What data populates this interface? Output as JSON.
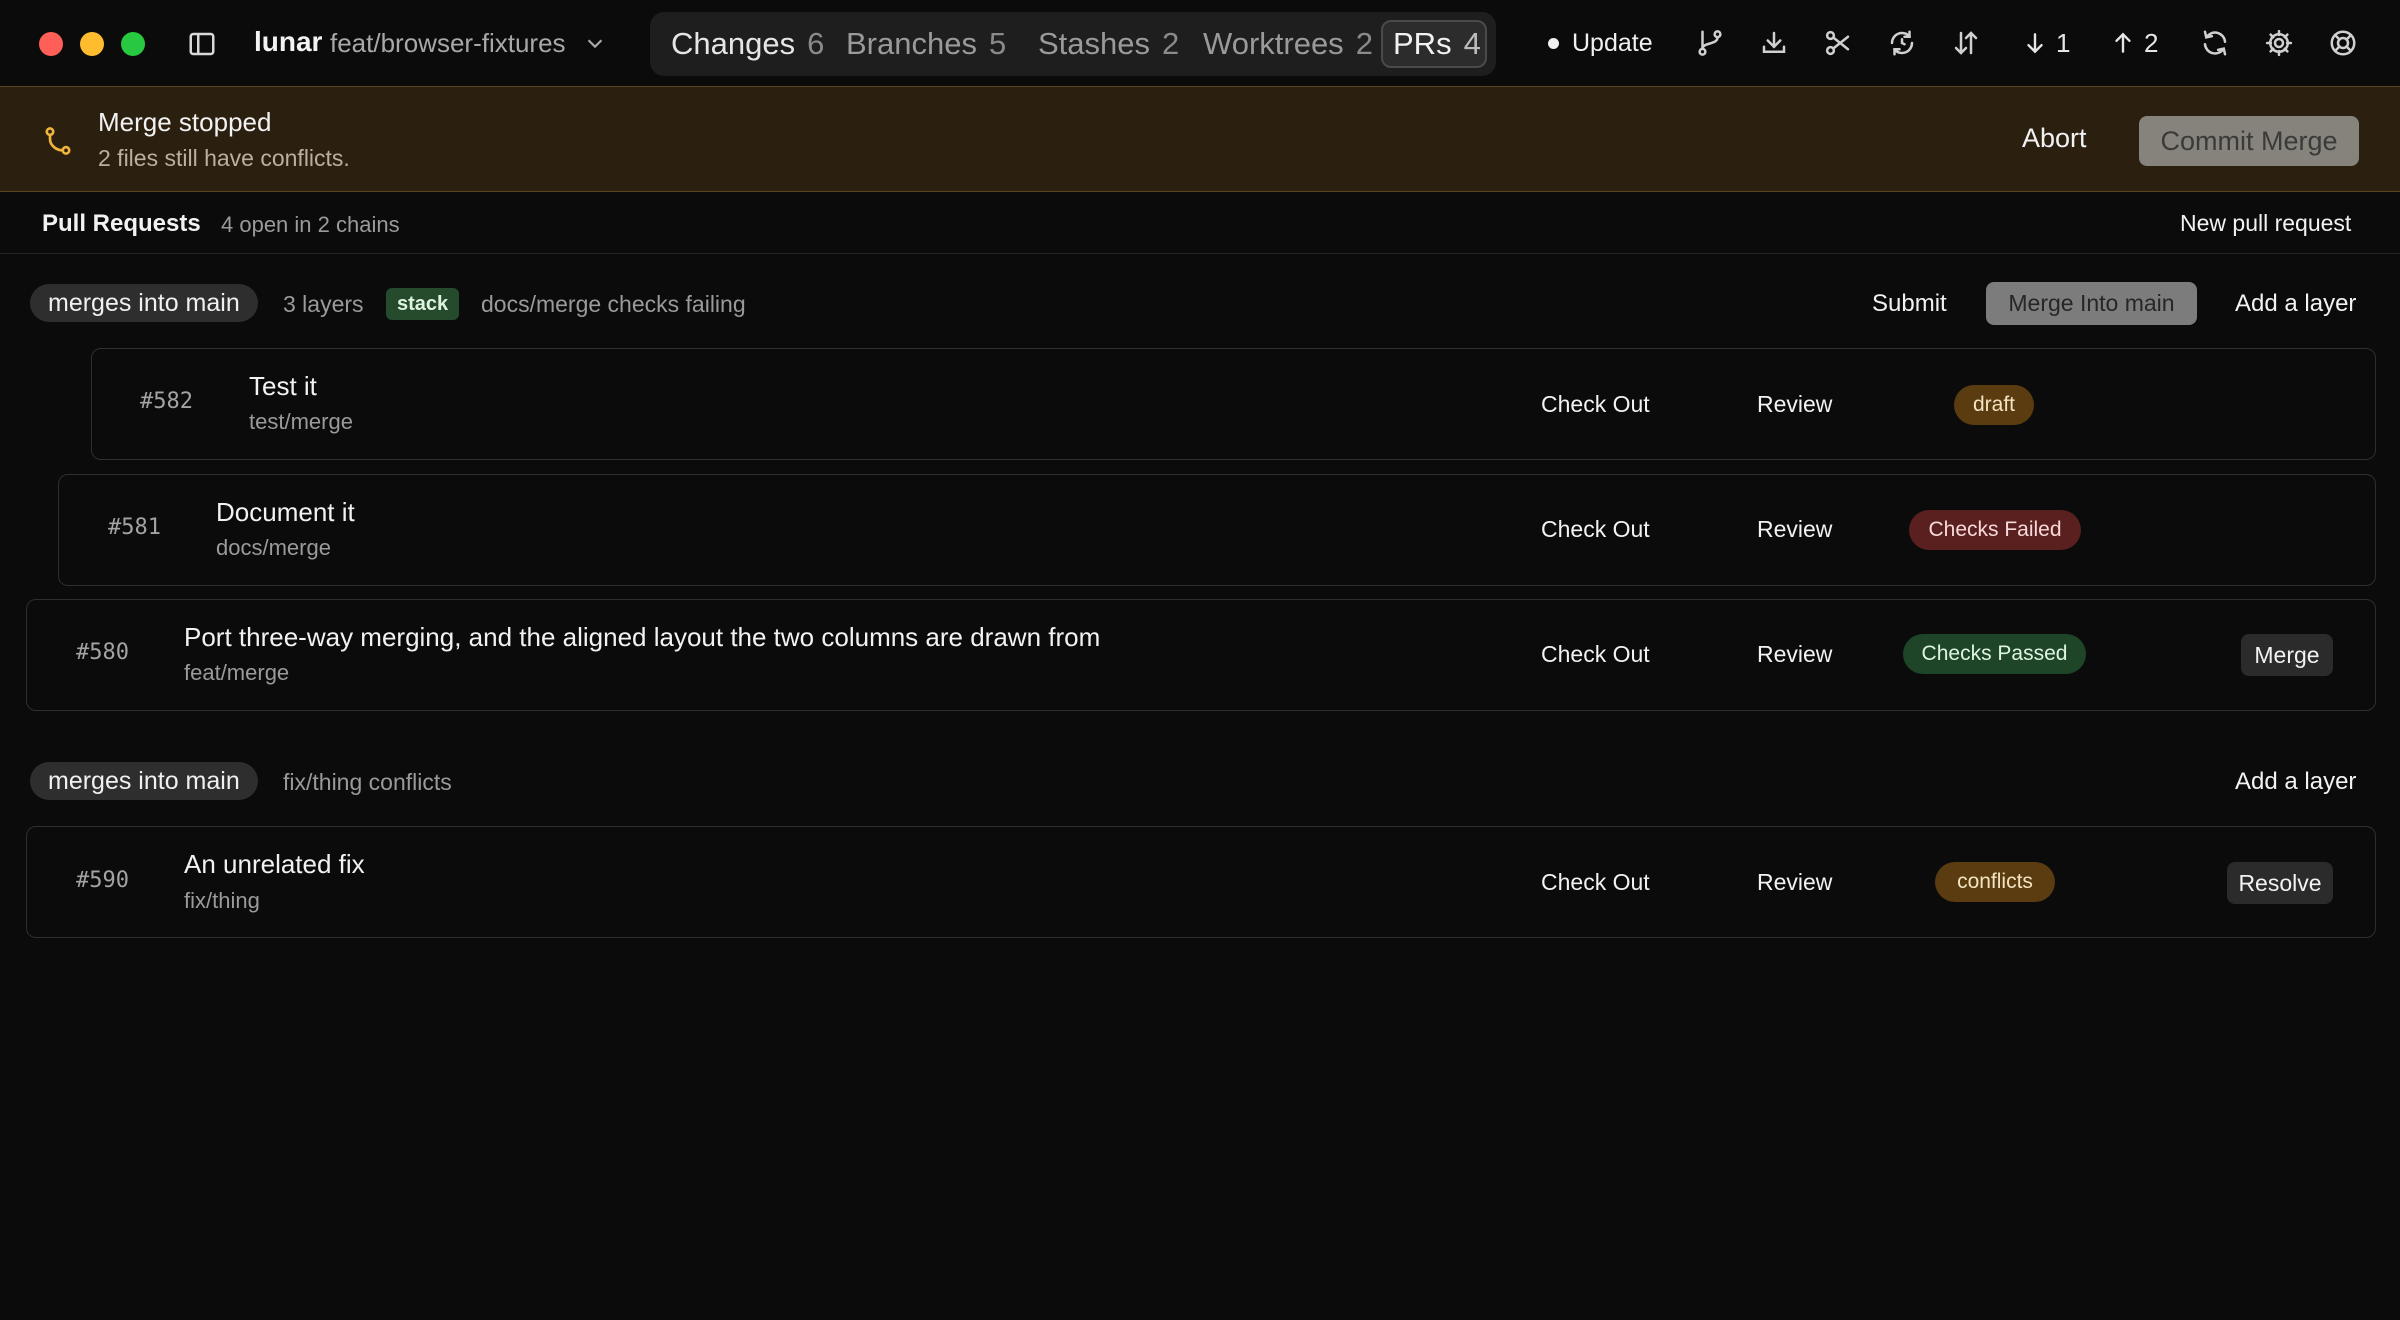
{
  "app": {
    "repo": "lunar",
    "branch": "feat/browser-fixtures",
    "tabs": [
      {
        "label": "Changes",
        "count": "6"
      },
      {
        "label": "Branches",
        "count": "5"
      },
      {
        "label": "Stashes",
        "count": "2"
      },
      {
        "label": "Worktrees",
        "count": "2"
      },
      {
        "label": "PRs",
        "count": "4",
        "selected": true
      }
    ],
    "update_label": "Update",
    "pull_count": "1",
    "push_count": "2",
    "toolbar_icons": [
      "branch-icon",
      "download-icon",
      "scissors-icon",
      "sync-history-icon",
      "sort-arrows-icon",
      "arrow-down-icon",
      "arrow-up-icon",
      "refresh-icon",
      "gear-icon",
      "help-lifebuoy-icon"
    ]
  },
  "banner": {
    "title": "Merge stopped",
    "subtitle": "2 files still have conflicts.",
    "abort_label": "Abort",
    "commit_label": "Commit Merge",
    "accent": "#f0b43c"
  },
  "pull_requests": {
    "title": "Pull Requests",
    "summary": "4 open in 2 chains",
    "new_label": "New pull request",
    "chains": [
      {
        "target": "merges into main",
        "layers": "3 layers",
        "badge": "stack",
        "status": "docs/merge checks failing",
        "submit_label": "Submit",
        "merge_label": "Merge Into main",
        "add_layer_label": "Add a layer",
        "prs": [
          {
            "number": "#582",
            "title": "Test it",
            "branch": "test/merge",
            "checkout": "Check Out",
            "review": "Review",
            "status": "draft"
          },
          {
            "number": "#581",
            "title": "Document it",
            "branch": "docs/merge",
            "checkout": "Check Out",
            "review": "Review",
            "status": "Checks Failed"
          },
          {
            "number": "#580",
            "title": "Port three-way merging, and the aligned layout the two columns are drawn from",
            "branch": "feat/merge",
            "checkout": "Check Out",
            "review": "Review",
            "status": "Checks Passed",
            "action": "Merge"
          }
        ]
      },
      {
        "target": "merges into main",
        "status": "fix/thing conflicts",
        "add_layer_label": "Add a layer",
        "prs": [
          {
            "number": "#590",
            "title": "An unrelated fix",
            "branch": "fix/thing",
            "checkout": "Check Out",
            "review": "Review",
            "status": "conflicts",
            "action": "Resolve"
          }
        ]
      }
    ]
  }
}
